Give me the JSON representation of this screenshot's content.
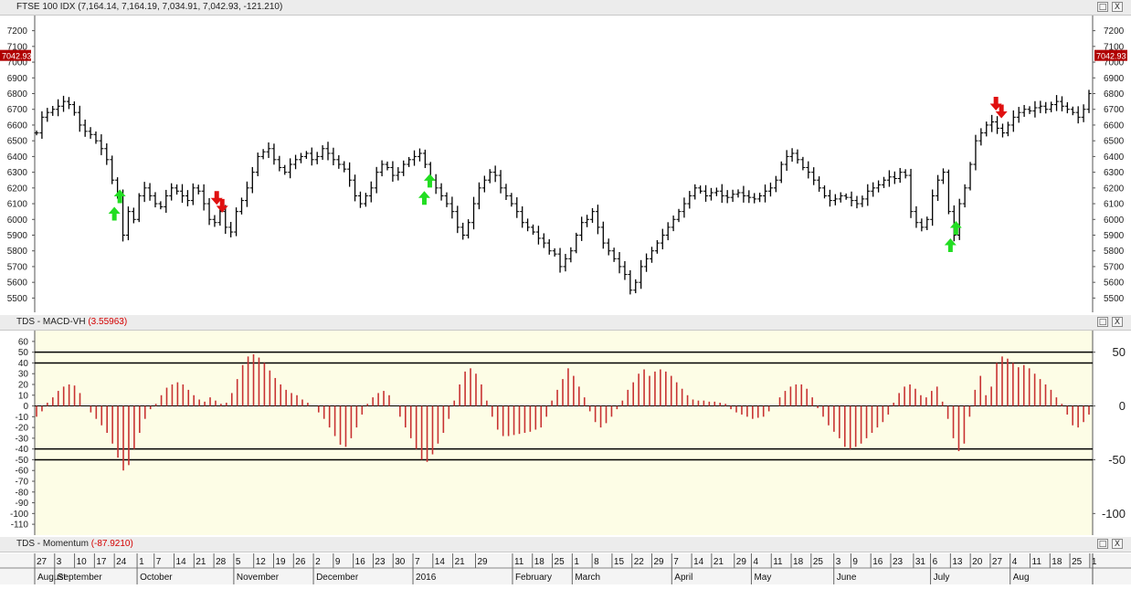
{
  "price_panel": {
    "title": "FTSE 100 IDX",
    "ohlc_text": "(7,164.14, 7,164.19, 7,034.91, 7,042.93, -121.210)",
    "last_price_tag": "7042.93",
    "tag_color": "#b00000",
    "buttons": [
      "□",
      "X"
    ]
  },
  "macd_panel": {
    "title": "TDS - MACD-VH",
    "value_text": "(3.55963)",
    "background": "#fdfde6",
    "bar_color": "#c83232",
    "buttons": [
      "□",
      "X"
    ]
  },
  "momentum_panel": {
    "title": "TDS - Momentum",
    "value_text": "(-87.9210)",
    "buttons": [
      "□",
      "X"
    ]
  },
  "time_axis": {
    "day_ticks": [
      "27",
      "3",
      "10",
      "17",
      "24",
      "1",
      "7",
      "14",
      "21",
      "28",
      "5",
      "12",
      "19",
      "26",
      "2",
      "9",
      "16",
      "23",
      "30",
      "7",
      "14",
      "21",
      "29",
      "11",
      "18",
      "25",
      "1",
      "8",
      "15",
      "22",
      "29",
      "7",
      "14",
      "21",
      "29",
      "4",
      "11",
      "18",
      "25",
      "3",
      "9",
      "16",
      "23",
      "31",
      "6",
      "13",
      "20",
      "27",
      "4",
      "11",
      "18",
      "25",
      "1"
    ],
    "month_labels": [
      "August",
      "September",
      "October",
      "November",
      "December",
      "2016",
      "February",
      "March",
      "April",
      "May",
      "June",
      "July",
      "Aug"
    ]
  },
  "chart_data": [
    {
      "type": "ohlc",
      "series_name": "FTSE 100 IDX",
      "ylim": [
        5450,
        7250
      ],
      "y_ticks": [
        5500,
        5600,
        5700,
        5800,
        5900,
        6000,
        6100,
        6200,
        6300,
        6400,
        6500,
        6600,
        6700,
        6800,
        6900,
        7000,
        7100,
        7200
      ],
      "x_range": [
        "2015-07-27",
        "2016-08-02"
      ],
      "closes": [
        6550,
        6650,
        6680,
        6700,
        6720,
        6750,
        6730,
        6680,
        6600,
        6560,
        6540,
        6500,
        6450,
        6380,
        6250,
        6150,
        5900,
        6050,
        6000,
        6150,
        6200,
        6150,
        6100,
        6080,
        6150,
        6200,
        6180,
        6150,
        6120,
        6200,
        6180,
        6100,
        6000,
        5980,
        6050,
        5950,
        5920,
        6050,
        6120,
        6200,
        6300,
        6400,
        6430,
        6450,
        6380,
        6330,
        6300,
        6350,
        6380,
        6400,
        6420,
        6380,
        6400,
        6450,
        6420,
        6380,
        6350,
        6320,
        6250,
        6150,
        6100,
        6150,
        6200,
        6300,
        6350,
        6330,
        6280,
        6300,
        6350,
        6380,
        6400,
        6420,
        6350,
        6250,
        6200,
        6150,
        6100,
        6050,
        5950,
        5900,
        5980,
        6100,
        6200,
        6250,
        6300,
        6280,
        6200,
        6150,
        6100,
        6050,
        5980,
        5950,
        5920,
        5880,
        5850,
        5800,
        5780,
        5700,
        5750,
        5800,
        5900,
        5980,
        6000,
        6050,
        5950,
        5850,
        5800,
        5750,
        5700,
        5650,
        5550,
        5600,
        5700,
        5750,
        5800,
        5850,
        5900,
        5950,
        6000,
        6050,
        6100,
        6150,
        6200,
        6180,
        6150,
        6170,
        6180,
        6150,
        6140,
        6160,
        6170,
        6150,
        6140,
        6130,
        6150,
        6180,
        6200,
        6250,
        6350,
        6400,
        6420,
        6380,
        6330,
        6300,
        6250,
        6200,
        6150,
        6120,
        6130,
        6150,
        6140,
        6120,
        6100,
        6130,
        6180,
        6200,
        6220,
        6250,
        6270,
        6260,
        6300,
        6280,
        6050,
        5980,
        5950,
        6000,
        6150,
        6250,
        6300,
        6050,
        5900,
        6100,
        6200,
        6350,
        6500,
        6550,
        6600,
        6620,
        6580,
        6550,
        6600,
        6650,
        6680,
        6700,
        6690,
        6710,
        6720,
        6700,
        6730,
        6750,
        6720,
        6700,
        6680,
        6650,
        6700,
        6800
      ],
      "arrows": [
        {
          "date": "2015-08-24",
          "direction": "up",
          "color": "#22dd22"
        },
        {
          "date": "2015-09-29",
          "direction": "down",
          "color": "#e01010"
        },
        {
          "date": "2015-12-11",
          "direction": "up",
          "color": "#22dd22"
        },
        {
          "date": "2016-06-13",
          "direction": "up",
          "color": "#22dd22"
        },
        {
          "date": "2016-06-29",
          "direction": "down",
          "color": "#e01010"
        }
      ]
    },
    {
      "type": "bar",
      "series_name": "TDS - MACD-VH",
      "ylim": [
        -115,
        65
      ],
      "left_ticks": [
        60,
        50,
        40,
        30,
        20,
        10,
        0,
        -10,
        -20,
        -30,
        -40,
        -50,
        -60,
        -70,
        -80,
        -90,
        -100,
        -110
      ],
      "right_ticks": [
        50,
        0,
        -50,
        -100
      ],
      "reference_lines": [
        50,
        40,
        -40,
        -50
      ],
      "values": [
        -10,
        -5,
        3,
        8,
        14,
        18,
        20,
        19,
        12,
        0,
        -6,
        -12,
        -18,
        -25,
        -35,
        -48,
        -60,
        -55,
        -40,
        -25,
        -12,
        -3,
        2,
        10,
        17,
        20,
        22,
        20,
        15,
        10,
        6,
        4,
        8,
        5,
        2,
        3,
        12,
        25,
        38,
        46,
        48,
        45,
        40,
        33,
        26,
        20,
        15,
        12,
        10,
        6,
        3,
        0,
        -6,
        -12,
        -20,
        -28,
        -36,
        -38,
        -30,
        -20,
        -8,
        2,
        8,
        12,
        14,
        10,
        0,
        -10,
        -20,
        -30,
        -40,
        -50,
        -52,
        -45,
        -35,
        -25,
        -12,
        5,
        20,
        32,
        35,
        30,
        20,
        5,
        -10,
        -22,
        -28,
        -28,
        -27,
        -26,
        -25,
        -24,
        -22,
        -20,
        -10,
        5,
        15,
        25,
        35,
        28,
        18,
        8,
        -5,
        -15,
        -20,
        -16,
        -10,
        -3,
        5,
        15,
        22,
        30,
        34,
        28,
        32,
        34,
        32,
        28,
        22,
        16,
        10,
        6,
        5,
        5,
        4,
        4,
        3,
        2,
        -3,
        -6,
        -8,
        -10,
        -12,
        -11,
        -10,
        -5,
        0,
        8,
        14,
        18,
        20,
        20,
        16,
        8,
        -2,
        -10,
        -18,
        -24,
        -30,
        -38,
        -40,
        -38,
        -35,
        -30,
        -25,
        -20,
        -15,
        -8,
        3,
        12,
        18,
        20,
        16,
        10,
        8,
        14,
        18,
        4,
        -12,
        -30,
        -42,
        -35,
        -10,
        15,
        28,
        10,
        18,
        40,
        46,
        44,
        40,
        36,
        38,
        35,
        30,
        25,
        20,
        15,
        8,
        2,
        -8,
        -18,
        -20,
        -15,
        -8
      ]
    }
  ]
}
